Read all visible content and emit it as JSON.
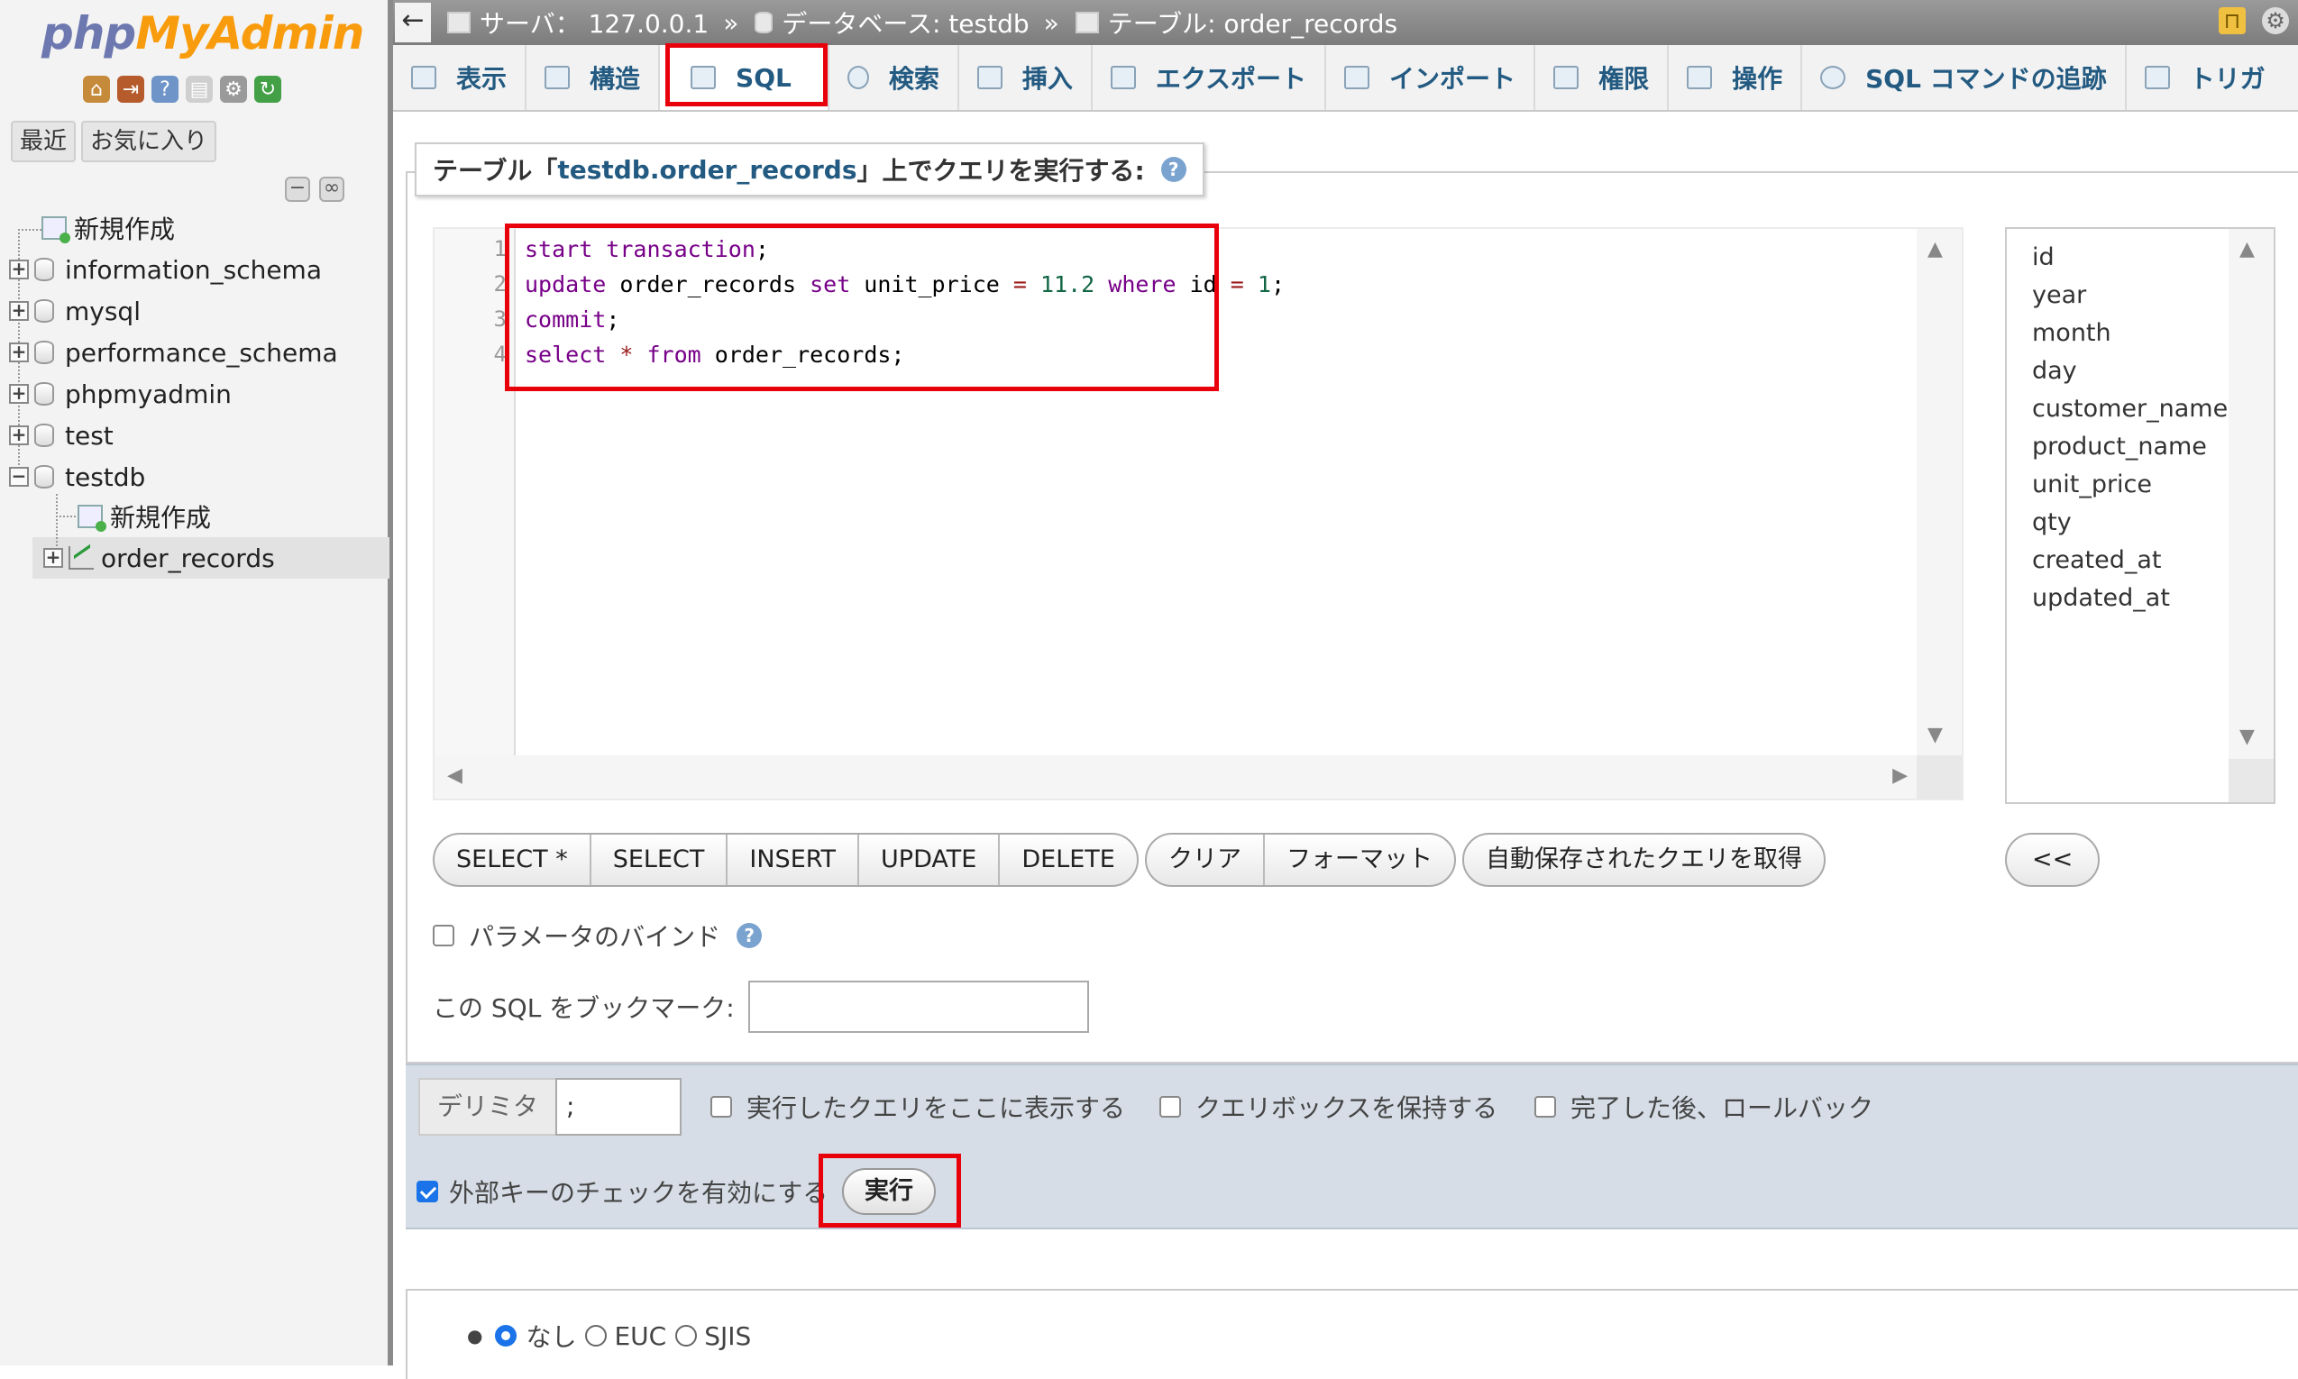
{
  "app": {
    "logo_php": "php",
    "logo_myadmin": "MyAdmin"
  },
  "nav": {
    "tab_recent": "最近",
    "tab_favorites": "お気に入り",
    "tree": [
      {
        "label": "新規作成"
      },
      {
        "label": "information_schema"
      },
      {
        "label": "mysql"
      },
      {
        "label": "performance_schema"
      },
      {
        "label": "phpmyadmin"
      },
      {
        "label": "test"
      },
      {
        "label": "testdb"
      },
      {
        "label": "新規作成"
      },
      {
        "label": "order_records"
      }
    ]
  },
  "breadcrumb": {
    "back": "←",
    "server": "サーバ： 127.0.0.1",
    "database": "データベース: testdb",
    "table": "テーブル: order_records",
    "separator": "»"
  },
  "tabs": [
    {
      "label": "表示"
    },
    {
      "label": "構造"
    },
    {
      "label": "SQL"
    },
    {
      "label": "検索"
    },
    {
      "label": "挿入"
    },
    {
      "label": "エクスポート"
    },
    {
      "label": "インポート"
    },
    {
      "label": "権限"
    },
    {
      "label": "操作"
    },
    {
      "label": "SQL コマンドの追跡"
    },
    {
      "label": "トリガ"
    }
  ],
  "query": {
    "legend_prefix": "テーブル「",
    "legend_table": "testdb.order_records",
    "legend_suffix": "」上でクエリを実行する:",
    "line_numbers": [
      "1",
      "2",
      "3",
      "4"
    ]
  },
  "columns": [
    "id",
    "year",
    "month",
    "day",
    "customer_name",
    "product_name",
    "unit_price",
    "qty",
    "created_at",
    "updated_at"
  ],
  "buttons": {
    "select_star": "SELECT *",
    "select": "SELECT",
    "insert": "INSERT",
    "update": "UPDATE",
    "delete": "DELETE",
    "clear": "クリア",
    "format": "フォーマット",
    "autosaved": "自動保存されたクエリを取得",
    "insert_column": "<<"
  },
  "options": {
    "bind_params": "パラメータのバインド",
    "bookmark_label": "この SQL をブックマーク:",
    "delimiter_label": "デリミタ",
    "delimiter_value": ";",
    "show_query": "実行したクエリをここに表示する",
    "keep_box": "クエリボックスを保持する",
    "rollback": "完了した後、ロールバック",
    "fk_checks": "外部キーのチェックを有効にする",
    "go": "実行"
  },
  "charset": {
    "none": "なし",
    "euc": "EUC",
    "sjis": "SJIS"
  }
}
